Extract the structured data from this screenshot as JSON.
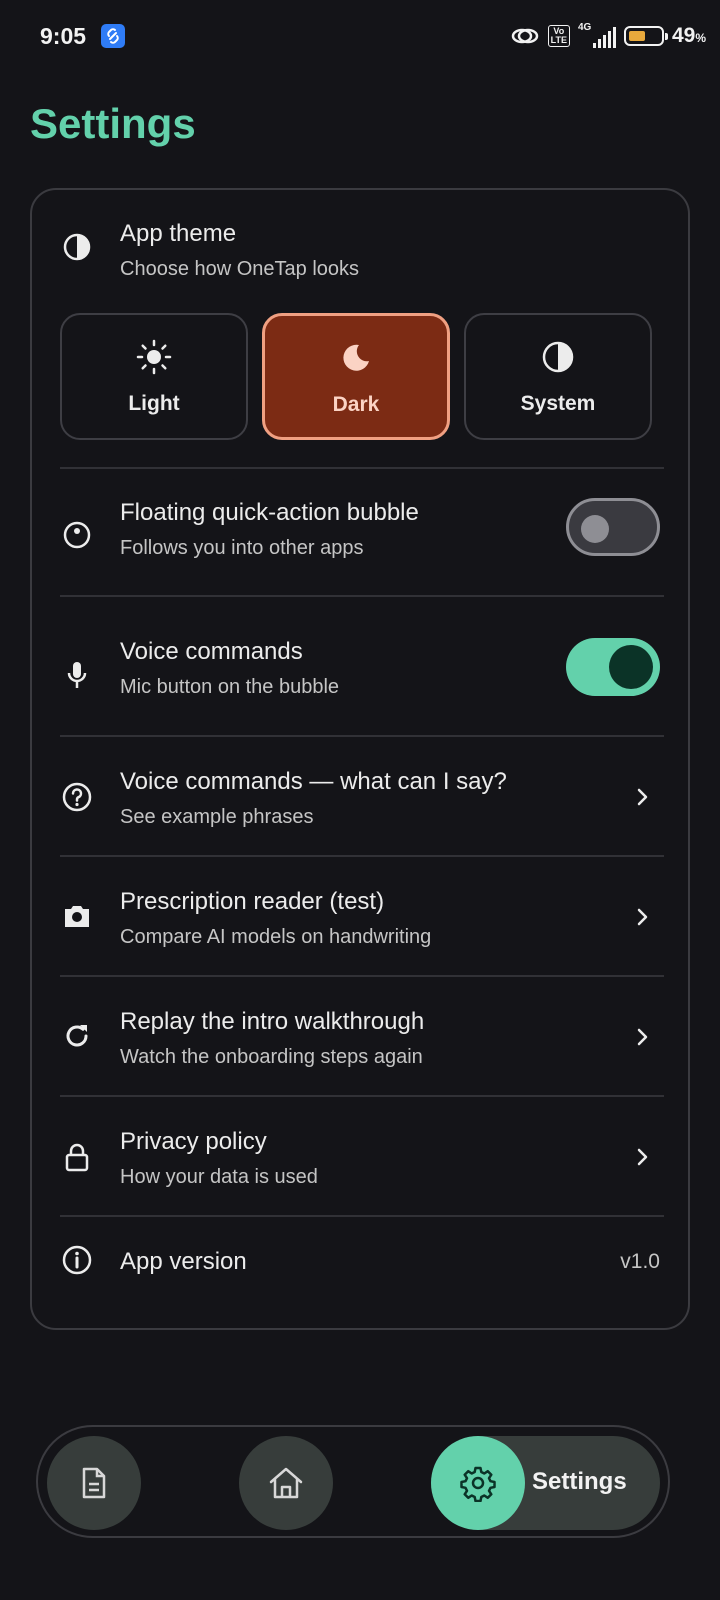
{
  "status_bar": {
    "time": "9:05",
    "volte": "Vo\nLTE",
    "network": "4G",
    "battery_level": 0.49,
    "battery_percent": "49",
    "battery_suffix": "%"
  },
  "page": {
    "title": "Settings"
  },
  "settings": {
    "theme": {
      "title": "App theme",
      "subtitle": "Choose how OneTap looks",
      "options": [
        {
          "label": "Light",
          "icon": "sun-icon"
        },
        {
          "label": "Dark",
          "icon": "moon-icon"
        },
        {
          "label": "System",
          "icon": "contrast-icon"
        }
      ],
      "selected": "Dark"
    },
    "bubble": {
      "title": "Floating quick-action bubble",
      "subtitle": "Follows you into other apps",
      "enabled": false,
      "icon": "bubble-icon"
    },
    "voice": {
      "title": "Voice commands",
      "subtitle": "Mic button on the bubble",
      "enabled": true,
      "icon": "mic-icon"
    },
    "voice_help": {
      "title": "Voice commands — what can I say?",
      "subtitle": "See example phrases",
      "icon": "help-circle-icon"
    },
    "prescription": {
      "title": "Prescription reader (test)",
      "subtitle": "Compare AI models on handwriting",
      "icon": "camera-icon"
    },
    "replay": {
      "title": "Replay the intro walkthrough",
      "subtitle": "Watch the onboarding steps again",
      "icon": "refresh-icon"
    },
    "privacy": {
      "title": "Privacy policy",
      "subtitle": "How your data is used",
      "icon": "lock-icon"
    },
    "version": {
      "title": "App version",
      "value": "v1.0",
      "icon": "info-icon"
    }
  },
  "bottom_nav": {
    "items": [
      {
        "icon": "document-icon"
      },
      {
        "icon": "home-icon"
      },
      {
        "icon": "gear-icon",
        "label": "Settings"
      }
    ],
    "active": "Settings"
  },
  "colors": {
    "accent": "#63D1AB",
    "background": "#141418",
    "dark_selected": "#7C2B14",
    "dark_border": "#F0A082"
  }
}
